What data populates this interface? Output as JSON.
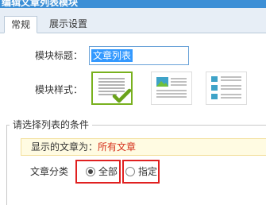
{
  "window": {
    "title": "编辑文章列表模块"
  },
  "tabs": [
    {
      "label": "常规"
    },
    {
      "label": "展示设置"
    }
  ],
  "form": {
    "module_title_label": "模块标题：",
    "module_title_value": "文章列表",
    "module_style_label": "模块样式：",
    "style_options": [
      {
        "icon": "text-list-icon",
        "selected": true
      },
      {
        "icon": "image-text-list-icon",
        "selected": false
      },
      {
        "icon": "thumbnail-list-icon",
        "selected": false
      }
    ]
  },
  "condition_section": {
    "legend": "请选择列表的条件",
    "notice_prefix": "显示的文章为：",
    "notice_value": "所有文章",
    "category_label": "文章分类",
    "options": [
      {
        "label": "全部",
        "checked": true
      },
      {
        "label": "指定",
        "checked": false
      }
    ]
  },
  "colors": {
    "titlebar": "#3c8fd6",
    "selected_border": "#79b11f",
    "checkmark": "#6aa31a",
    "highlight_text": "#d6301b",
    "annotation_box": "#e02020",
    "notice_bg": "#fffbe2"
  }
}
